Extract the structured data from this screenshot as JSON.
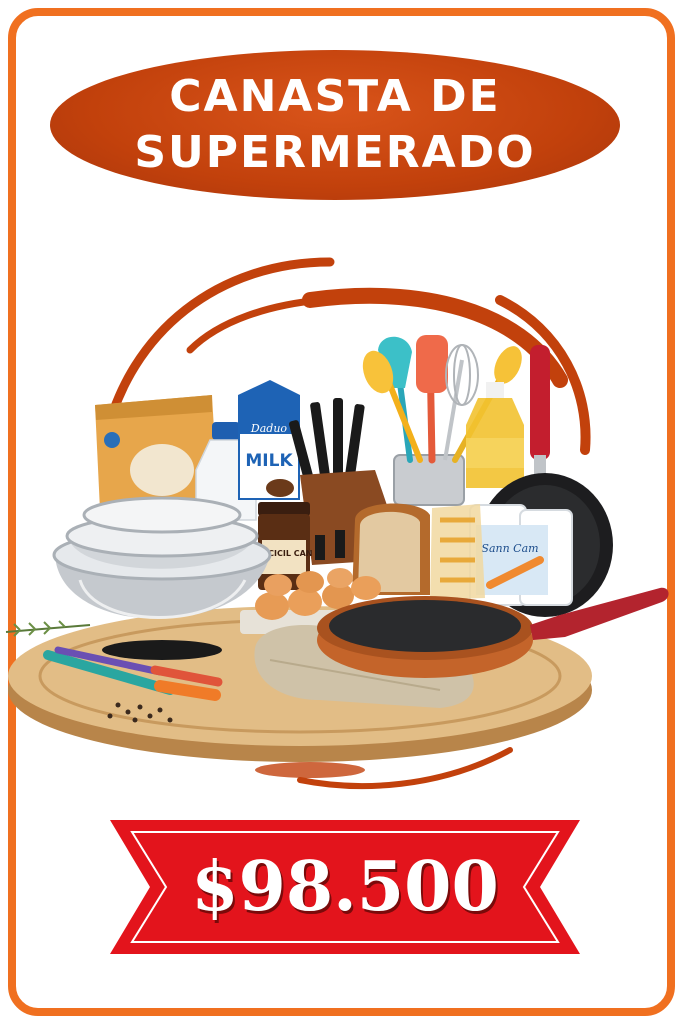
{
  "title": {
    "line1": "CANASTA DE",
    "line2": "SUPERMERADO"
  },
  "products": {
    "flour_bag_brand": "",
    "milk_carton_brand": "Daduo",
    "milk_carton_label": "MILK",
    "coffee_jar_label": "KOCICIL CAN",
    "paper_towel_label": "Sann Cam"
  },
  "price": {
    "text": "$98.500"
  },
  "colors": {
    "frame": "#f07020",
    "title_bg": "#c2410c",
    "price_banner": "#e3141c",
    "swirl": "#c2410c"
  }
}
